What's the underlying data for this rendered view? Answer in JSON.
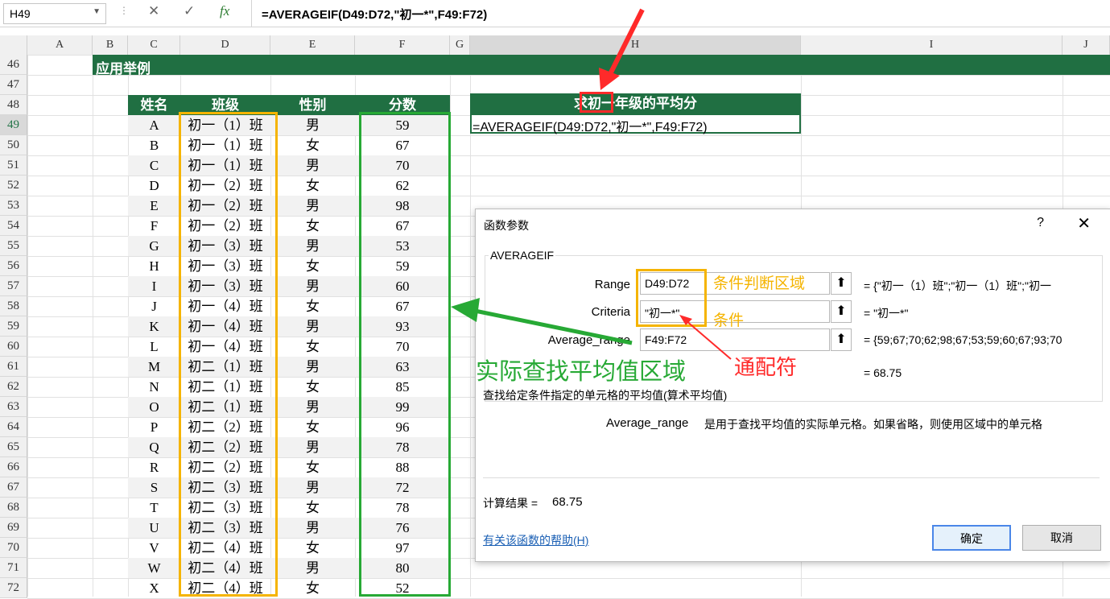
{
  "formula_bar": {
    "cell_ref": "H49",
    "cancel_icon": "✕",
    "enter_icon": "✓",
    "fx_label": "fx",
    "formula": "=AVERAGEIF(D49:D72,\"初一*\",F49:F72)"
  },
  "columns": [
    "A",
    "B",
    "C",
    "D",
    "E",
    "F",
    "G",
    "H",
    "I",
    "J"
  ],
  "rows": [
    "46",
    "47",
    "48",
    "49",
    "50",
    "51",
    "52",
    "53",
    "54",
    "55",
    "56",
    "57",
    "58",
    "59",
    "60",
    "61",
    "62",
    "63",
    "64",
    "65",
    "66",
    "67",
    "68",
    "69",
    "70",
    "71",
    "72"
  ],
  "section_title": "应用举例",
  "table": {
    "headers": [
      "姓名",
      "班级",
      "性别",
      "分数"
    ],
    "records": [
      [
        "A",
        "初一（1）班",
        "男",
        "59"
      ],
      [
        "B",
        "初一（1）班",
        "女",
        "67"
      ],
      [
        "C",
        "初一（1）班",
        "男",
        "70"
      ],
      [
        "D",
        "初一（2）班",
        "女",
        "62"
      ],
      [
        "E",
        "初一（2）班",
        "男",
        "98"
      ],
      [
        "F",
        "初一（2）班",
        "女",
        "67"
      ],
      [
        "G",
        "初一（3）班",
        "男",
        "53"
      ],
      [
        "H",
        "初一（3）班",
        "女",
        "59"
      ],
      [
        "I",
        "初一（3）班",
        "男",
        "60"
      ],
      [
        "J",
        "初一（4）班",
        "女",
        "67"
      ],
      [
        "K",
        "初一（4）班",
        "男",
        "93"
      ],
      [
        "L",
        "初一（4）班",
        "女",
        "70"
      ],
      [
        "M",
        "初二（1）班",
        "男",
        "63"
      ],
      [
        "N",
        "初二（1）班",
        "女",
        "85"
      ],
      [
        "O",
        "初二（1）班",
        "男",
        "99"
      ],
      [
        "P",
        "初二（2）班",
        "女",
        "96"
      ],
      [
        "Q",
        "初二（2）班",
        "男",
        "78"
      ],
      [
        "R",
        "初二（2）班",
        "女",
        "88"
      ],
      [
        "S",
        "初二（3）班",
        "男",
        "72"
      ],
      [
        "T",
        "初二（3）班",
        "女",
        "78"
      ],
      [
        "U",
        "初二（3）班",
        "男",
        "76"
      ],
      [
        "V",
        "初二（4）班",
        "女",
        "97"
      ],
      [
        "W",
        "初二（4）班",
        "男",
        "80"
      ],
      [
        "X",
        "初二（4）班",
        "女",
        "52"
      ]
    ]
  },
  "result_box": {
    "title": "求初一年级的平均分",
    "formula": "=AVERAGEIF(D49:D72,\"初一*\",F49:F72)"
  },
  "dialog": {
    "title": "函数参数",
    "help_icon": "?",
    "close_icon": "✕",
    "function_name": "AVERAGEIF",
    "args": [
      {
        "label": "Range",
        "value": "D49:D72",
        "result": "=  {\"初一（1）班\";\"初一（1）班\";\"初一"
      },
      {
        "label": "Criteria",
        "value": "\"初一*\"",
        "result": "=  \"初一*\""
      },
      {
        "label": "Average_range",
        "value": "F49:F72",
        "result": "=  {59;67;70;62;98;67;53;59;60;67;93;70"
      }
    ],
    "ref_icon": "⬆",
    "total_result": "=  68.75",
    "description": "查找给定条件指定的单元格的平均值(算术平均值)",
    "arg_help_name": "Average_range",
    "arg_help_text": "是用于查找平均值的实际单元格。如果省略，则使用区域中的单元格",
    "calc_label": "计算结果 =",
    "calc_value": "68.75",
    "help_link": "有关该函数的帮助(H)",
    "ok_label": "确定",
    "cancel_label": "取消"
  },
  "annotations": {
    "range_note": "条件判断区域",
    "criteria_note": "条件",
    "wildcard_note": "通配符",
    "avg_note": "实际查找平均值区域"
  },
  "colors": {
    "header_green": "#206f42",
    "orange": "#f5b400",
    "green": "#27a935",
    "red": "#ff2a2a"
  }
}
